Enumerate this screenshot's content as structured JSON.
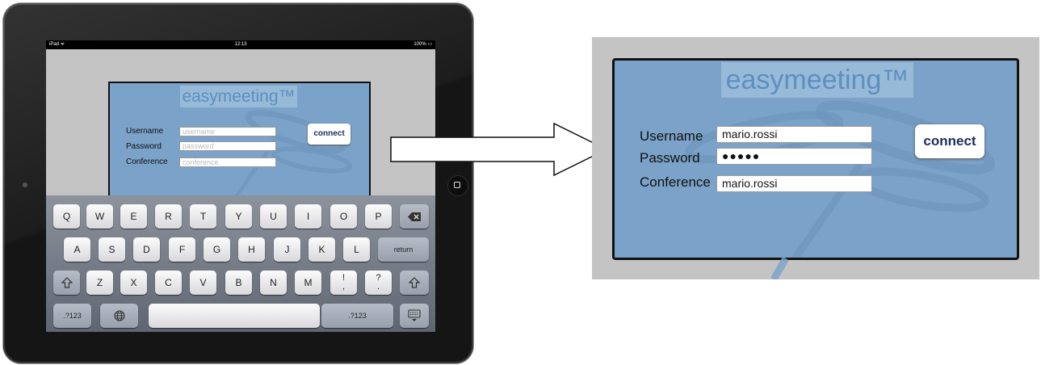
{
  "ipad": {
    "status": {
      "device": "iPad ᯤ",
      "time": "12:13",
      "battery": "100% ▭"
    },
    "login": {
      "brand": "easymeeting™",
      "username_label": "Username",
      "password_label": "Password",
      "conference_label": "Conference",
      "username_placeholder": "username",
      "password_placeholder": "password",
      "conference_placeholder": "conference",
      "connect_label": "connect"
    },
    "keyboard": {
      "row1": [
        "Q",
        "W",
        "E",
        "R",
        "T",
        "Y",
        "U",
        "I",
        "O",
        "P"
      ],
      "row2": [
        "A",
        "S",
        "D",
        "F",
        "G",
        "H",
        "J",
        "K",
        "L"
      ],
      "row3": [
        "Z",
        "X",
        "C",
        "V",
        "B",
        "N",
        "M"
      ],
      "return_label": "return",
      "numbers_label": ".?123",
      "excl_top": "!",
      "excl_bottom": ",",
      "quest_top": "?",
      "quest_bottom": "."
    }
  },
  "zoomed": {
    "brand": "easymeeting™",
    "username_label": "Username",
    "password_label": "Password",
    "conference_label": "Conference",
    "username_value": "mario.rossi",
    "password_value": "●●●●●",
    "conference_value": "mario.rossi",
    "connect_label": "connect"
  },
  "icons": {
    "backspace": "backspace-icon",
    "shift": "shift-icon",
    "globe": "globe-icon",
    "hide_keyboard": "hide-keyboard-icon",
    "home": "home-button-icon",
    "arrow": "right-arrow-icon"
  }
}
